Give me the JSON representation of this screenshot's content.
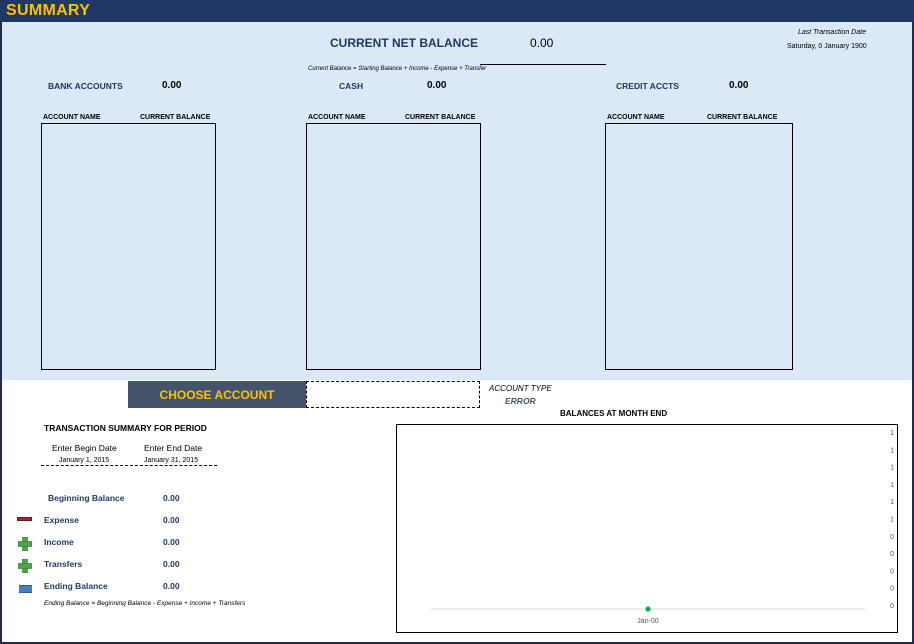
{
  "header": {
    "title": "SUMMARY"
  },
  "net": {
    "label": "CURRENT NET BALANCE",
    "value": "0.00",
    "formula": "Current Balance = Starting Balance + Income - Expense + Transfer",
    "last_txn_label": "Last Transaction Date",
    "last_txn_value": "Saturday, 0 January 1900"
  },
  "sections": [
    {
      "label": "BANK ACCOUNTS",
      "total": "0.00",
      "col1": "ACCOUNT NAME",
      "col2": "CURRENT BALANCE"
    },
    {
      "label": "CASH",
      "total": "0.00",
      "col1": "ACCOUNT NAME",
      "col2": "CURRENT BALANCE"
    },
    {
      "label": "CREDIT ACCTS",
      "total": "0.00",
      "col1": "ACCOUNT NAME",
      "col2": "CURRENT BALANCE"
    }
  ],
  "choose": {
    "button_label": "CHOOSE ACCOUNT",
    "field_value": "",
    "type_label": "ACCOUNT TYPE",
    "type_value": "ERROR"
  },
  "summary": {
    "title": "TRANSACTION SUMMARY FOR  PERIOD",
    "begin_label": "Enter Begin Date",
    "end_label": "Enter End Date",
    "begin_date": "January 1, 2015",
    "end_date": "January 31, 2015",
    "rows": [
      {
        "label": "Beginning Balance",
        "value": "0.00",
        "icon": "none"
      },
      {
        "label": "Expense",
        "value": "0.00",
        "icon": "minus-icon"
      },
      {
        "label": "Income",
        "value": "0.00",
        "icon": "plus-icon"
      },
      {
        "label": "Transfers",
        "value": "0.00",
        "icon": "plus-icon"
      },
      {
        "label": "Ending Balance",
        "value": "0.00",
        "icon": "equals-icon"
      }
    ],
    "formula": "Ending Balance = Beginning Balance - Expense + Income + Transfers"
  },
  "colors": {
    "header_bg": "#1f3864",
    "header_text": "#ffc000",
    "panel_bg": "#dbe9f6",
    "label_navy": "#1f3864",
    "minus_red": "#9e2a2b",
    "plus_green": "#4ca64c",
    "equals_blue": "#4a7ebb",
    "point_green": "#00b050"
  },
  "chart_data": {
    "type": "line",
    "title": "BALANCES AT MONTH END",
    "categories": [
      "Jan-00"
    ],
    "series": [
      {
        "values": [
          0
        ]
      }
    ],
    "y_tick_labels": [
      "1",
      "1",
      "1",
      "1",
      "1",
      "1",
      "0",
      "0",
      "0",
      "0",
      "0"
    ],
    "grid": false,
    "legend": "none"
  }
}
